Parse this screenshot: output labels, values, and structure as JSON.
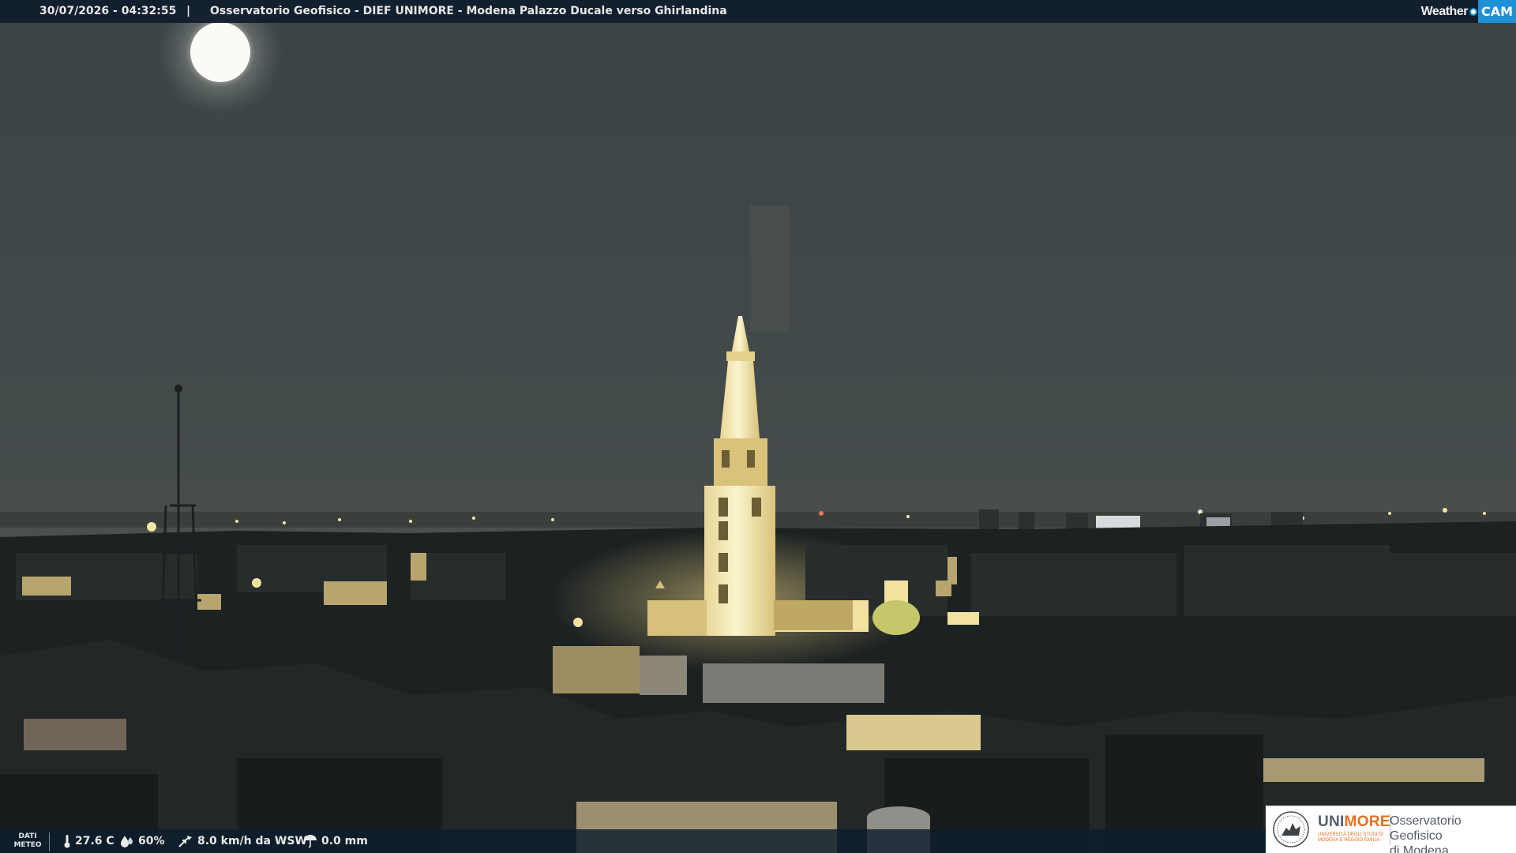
{
  "overlay": {
    "timestamp": "30/07/2026 - 04:32:55",
    "separator": "|",
    "title": "Osservatorio Geofisico - DIEF UNIMORE - Modena Palazzo Ducale verso Ghirlandina",
    "brand_word": "Weather",
    "brand_cam": "CAM"
  },
  "weather": {
    "label_line1": "DATI",
    "label_line2": "METEO",
    "temperature": "27.6 C",
    "humidity": "60%",
    "wind": "8.0 km/h da WSW",
    "rain": "0.0 mm"
  },
  "logo": {
    "uni_part1": "UNI",
    "uni_part2": "MORE",
    "uni_subtitle": "UNIVERSITÀ DEGLI STUDI DI MODENA E REGGIO EMILIA",
    "observatory_line1": "Osservatorio Geofisico",
    "observatory_line2": "di Modena"
  },
  "colors": {
    "sky": "#40474a",
    "tower_light": "#f4e9b0",
    "bar_bg": "#0e1c2c",
    "brand_blue": "#1f8fd6",
    "unimore_orange": "#e56f1f"
  },
  "icons": [
    "thermometer-icon",
    "humidity-drop-icon",
    "wind-icon",
    "rain-icon",
    "unimore-seal-icon"
  ]
}
